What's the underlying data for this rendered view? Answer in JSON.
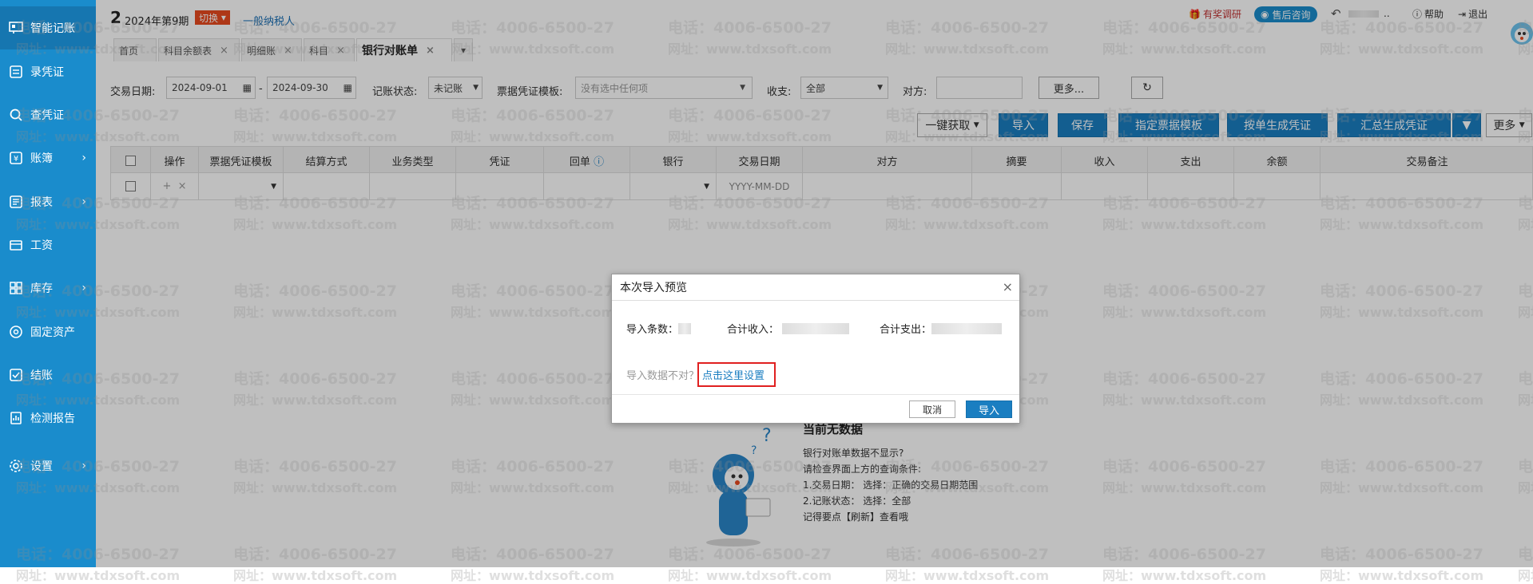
{
  "sidebar": {
    "items": [
      {
        "label": "智能记账",
        "icon": "smart-ledger-icon"
      },
      {
        "label": "录凭证",
        "icon": "voucher-entry-icon"
      },
      {
        "label": "查凭证",
        "icon": "search-icon"
      },
      {
        "label": "账簿",
        "icon": "ledger-icon"
      },
      {
        "label": "报表",
        "icon": "report-icon"
      },
      {
        "label": "工资",
        "icon": "salary-icon"
      },
      {
        "label": "库存",
        "icon": "inventory-icon"
      },
      {
        "label": "固定资产",
        "icon": "fixed-asset-icon"
      },
      {
        "label": "结账",
        "icon": "checkout-icon"
      },
      {
        "label": "检测报告",
        "icon": "inspection-report-icon"
      },
      {
        "label": "设置",
        "icon": "gear-icon"
      }
    ]
  },
  "header": {
    "company_num": "2",
    "period": "2024年第9期",
    "switch_label": "切换",
    "taxpayer": "一般纳税人",
    "survey": "有奖调研",
    "support": "售后咨询",
    "user_suffix": "..",
    "help": "帮助",
    "logout": "退出"
  },
  "tabs": [
    {
      "label": "首页"
    },
    {
      "label": "科目余额表"
    },
    {
      "label": "明细账"
    },
    {
      "label": "科目"
    },
    {
      "label": "银行对账单"
    }
  ],
  "filters": {
    "date_label": "交易日期:",
    "date_from": "2024-09-01",
    "date_to": "2024-09-30",
    "status_label": "记账状态:",
    "status_value": "未记账",
    "template_label": "票据凭证模板:",
    "template_placeholder": "没有选中任何项",
    "direction_label": "收支:",
    "direction_value": "全部",
    "counterparty_label": "对方:",
    "more": "更多..."
  },
  "toolbar": {
    "fetch": "一键获取",
    "import": "导入",
    "save": "保存",
    "assign_template": "指定票据模板",
    "generate_by_item": "按单生成凭证",
    "generate_summary": "汇总生成凭证",
    "more": "更多"
  },
  "table": {
    "columns": [
      "操作",
      "票据凭证模板",
      "结算方式",
      "业务类型",
      "凭证",
      "回单",
      "银行",
      "交易日期",
      "对方",
      "摘要",
      "收入",
      "支出",
      "余额",
      "交易备注"
    ],
    "row_date_placeholder": "YYYY-MM-DD"
  },
  "empty_state": {
    "title": "当前无数据",
    "lines": [
      "银行对账单数据不显示?",
      "请检查界面上方的查询条件:",
      "1.交易日期： 选择：正确的交易日期范围",
      "2.记账状态： 选择：全部",
      "记得要点【刷新】查看哦"
    ]
  },
  "watermark": {
    "phone": "电话：4006-6500-27",
    "site": "网址：www.tdxsoft.com"
  },
  "dialog": {
    "title": "本次导入预览",
    "count_label": "导入条数：",
    "income_label": "合计收入：",
    "expense_label": "合计支出：",
    "hint_text": "导入数据不对？",
    "hint_link": "点击这里设置",
    "cancel": "取消",
    "confirm": "导入"
  },
  "colors": {
    "sidebar": "#1a8ccc",
    "primary": "#1a7ec1",
    "switch_badge": "#e84a1f",
    "highlight_box": "#e02020"
  }
}
